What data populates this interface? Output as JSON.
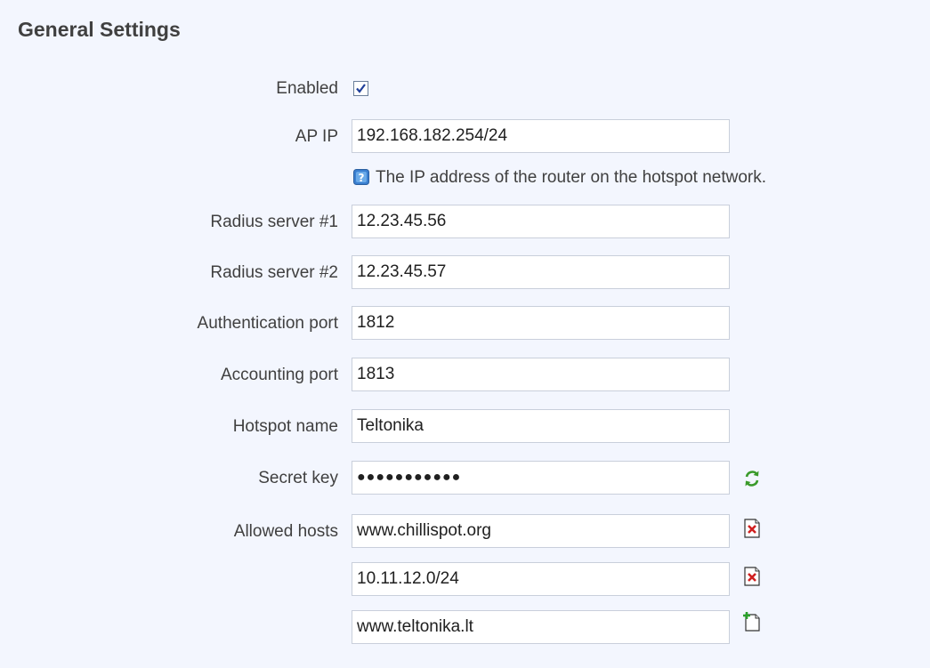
{
  "section": {
    "title": "General Settings"
  },
  "fields": {
    "enabled": {
      "label": "Enabled",
      "checked": true
    },
    "ap_ip": {
      "label": "AP IP",
      "value": "192.168.182.254/24",
      "hint": "The IP address of the router on the hotspot network."
    },
    "radius1": {
      "label": "Radius server #1",
      "value": "12.23.45.56"
    },
    "radius2": {
      "label": "Radius server #2",
      "value": "12.23.45.57"
    },
    "auth_port": {
      "label": "Authentication port",
      "value": "1812"
    },
    "acct_port": {
      "label": "Accounting port",
      "value": "1813"
    },
    "hotspot_name": {
      "label": "Hotspot name",
      "value": "Teltonika"
    },
    "secret_key": {
      "label": "Secret key",
      "value": "●●●●●●●●●●●"
    },
    "allowed_hosts": {
      "label": "Allowed hosts",
      "items": [
        "www.chillispot.org",
        "10.11.12.0/24",
        "www.teltonika.lt"
      ]
    }
  },
  "icons": {
    "help": "help-icon",
    "refresh": "refresh-icon",
    "remove": "remove-entry-icon",
    "add": "add-entry-icon"
  },
  "colors": {
    "background": "#f3f6fe",
    "field_border": "#c9cfdb",
    "help_blue": "#3a7fd0",
    "remove_red": "#d02020",
    "add_green": "#2aa02a"
  }
}
